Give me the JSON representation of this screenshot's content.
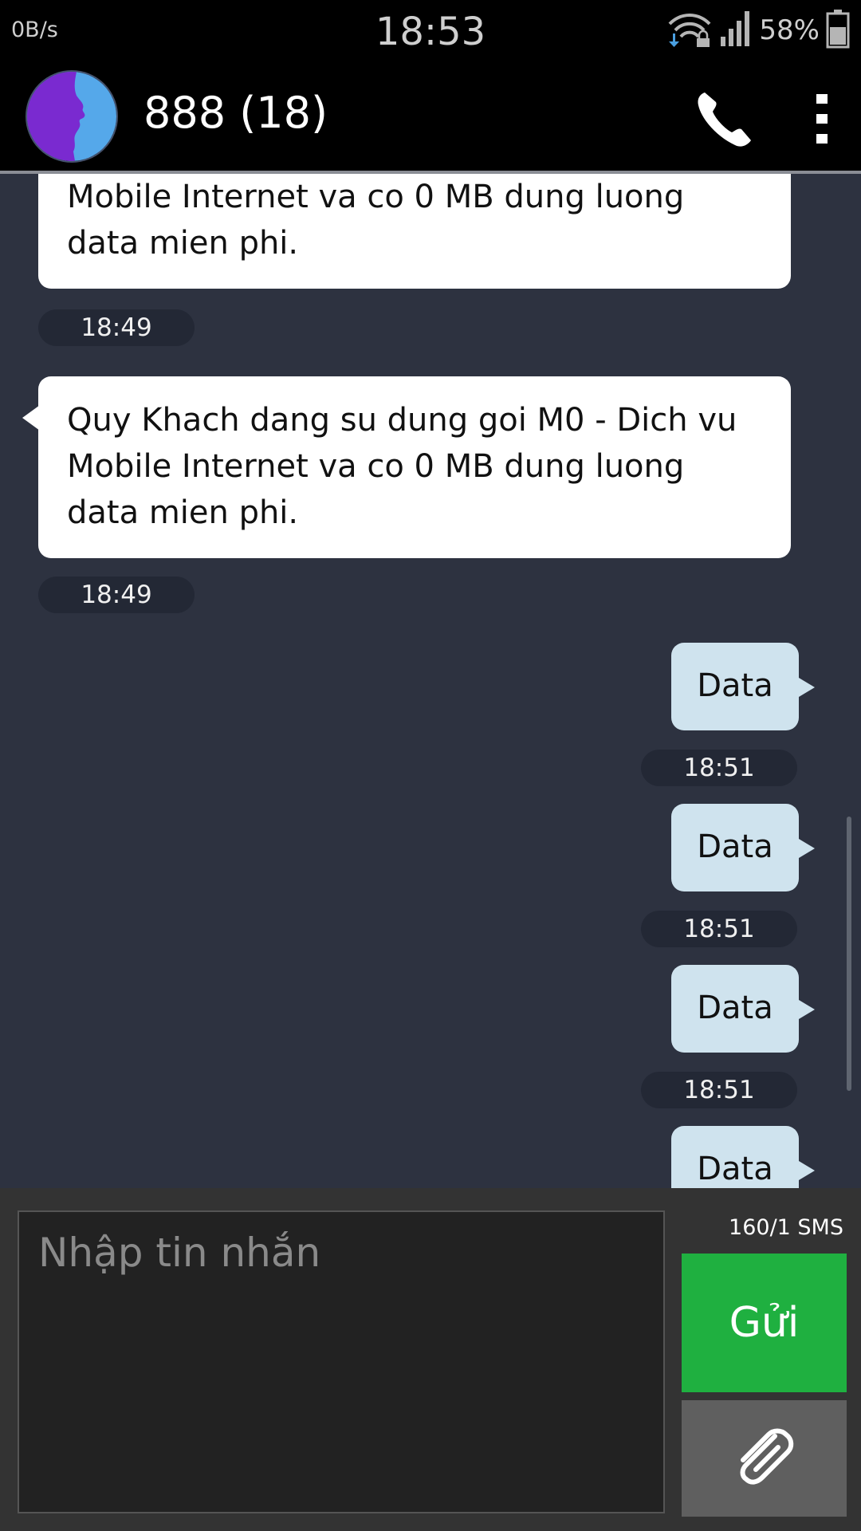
{
  "status_bar": {
    "net_speed": "0B/s",
    "time": "18:53",
    "battery_percent": "58%",
    "battery_level": 0.58,
    "icons": [
      "wifi-lock-icon",
      "signal-icon",
      "battery-icon"
    ]
  },
  "header": {
    "title": "888 (18)",
    "avatar_colors": {
      "left": "#7a2ad0",
      "right": "#55a8ea"
    },
    "icons": [
      "avatar-icon",
      "phone-icon",
      "overflow-menu-icon"
    ]
  },
  "messages": [
    {
      "direction": "incoming",
      "text": "Mobile Internet va co 0 MB dung luong data mien phi.",
      "time": "18:49"
    },
    {
      "direction": "incoming",
      "text": "Quy Khach dang su dung goi M0 - Dich vu Mobile Internet va co 0 MB dung luong data mien phi.",
      "time": "18:49"
    },
    {
      "direction": "outgoing",
      "text": "Data",
      "time": "18:51"
    },
    {
      "direction": "outgoing",
      "text": "Data",
      "time": "18:51"
    },
    {
      "direction": "outgoing",
      "text": "Data",
      "time": "18:51"
    },
    {
      "direction": "outgoing",
      "text": "Data",
      "time": ""
    }
  ],
  "compose": {
    "placeholder": "Nhập tin nhắn",
    "value": "",
    "counter": "160/1  SMS",
    "send_label": "Gửi",
    "send_color": "#1fb040",
    "attach_icon": "paperclip-icon"
  }
}
